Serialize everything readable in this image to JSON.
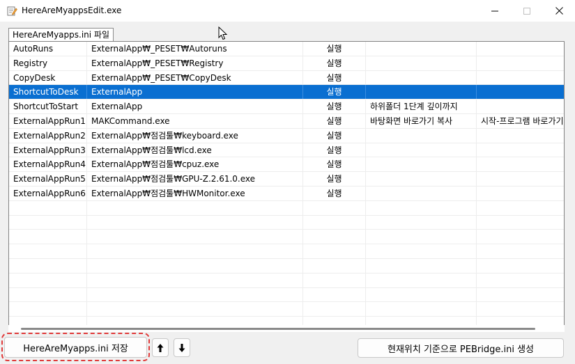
{
  "window": {
    "title": "HereAreMyappsEdit.exe",
    "icon": "notepad-edit-icon"
  },
  "tab": {
    "label": "HereAreMyapps.ini 파일"
  },
  "grid": {
    "rows": [
      [
        "AutoRuns",
        "ExternalApp₩_PESET₩Autoruns",
        "실행",
        "",
        ""
      ],
      [
        "Registry",
        "ExternalApp₩_PESET₩Registry",
        "실행",
        "",
        ""
      ],
      [
        "CopyDesk",
        "ExternalApp₩_PESET₩CopyDesk",
        "실행",
        "",
        ""
      ],
      [
        "ShortcutToDesk",
        "ExternalApp",
        "실행",
        "",
        ""
      ],
      [
        "ShortcutToStart",
        "ExternalApp",
        "실행",
        "하위폴더 1단계 깊이까지",
        ""
      ],
      [
        "ExternalAppRun1",
        "MAKCommand.exe",
        "실행",
        " 바탕화면 바로가기 복사",
        " 시작-프로그램 바로가기"
      ],
      [
        "ExternalAppRun2",
        "ExternalApp₩점검툴₩keyboard.exe",
        "실행",
        "",
        ""
      ],
      [
        "ExternalAppRun3",
        "ExternalApp₩점검툴₩lcd.exe",
        "실행",
        "",
        ""
      ],
      [
        "ExternalAppRun4",
        "ExternalApp₩점검툴₩cpuz.exe",
        "실행",
        "",
        ""
      ],
      [
        "ExternalAppRun5",
        "ExternalApp₩점검툴₩GPU-Z.2.61.0.exe",
        "실행",
        "",
        ""
      ],
      [
        "ExternalAppRun6",
        "ExternalApp₩점검툴₩HWMonitor.exe",
        "실행",
        "",
        ""
      ]
    ],
    "selected_row": 3,
    "empty_rows": 9
  },
  "buttons": {
    "save": "HereAreMyapps.ini 저장",
    "up": "up-arrow-icon",
    "down": "down-arrow-icon",
    "generate": "현재위치 기준으로 PEBridge.ini 생성"
  },
  "colors": {
    "selection": "#0a6fd1",
    "highlight_annotation": "#e03a3a"
  }
}
